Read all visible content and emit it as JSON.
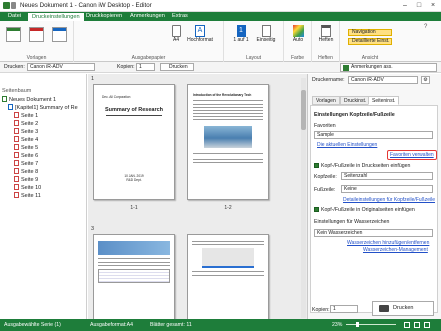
{
  "app": {
    "title": "Neues Dokument 1 - Canon iW Desktop - Editor"
  },
  "ribbon_tabs": [
    "Datei",
    "Druckeinstellungen",
    "Druckkopieren",
    "Anmerkungen",
    "Extras"
  ],
  "ribbon": {
    "groups": {
      "vorlagen": "Vorlagen",
      "ausgabepapier": "Ausgabepapier",
      "layout": "Layout",
      "farbe": "Farbe",
      "heften": "Heften",
      "ansicht": "Ansicht"
    },
    "buttons": {
      "paper_size": "A4",
      "orientation": "Hochformat",
      "pages_per_sheet": "1 auf 1",
      "duplex": "Einseitig",
      "color": "Auto",
      "staple": "Heften",
      "navigation": "Navigation",
      "detailed_info": "Detaillierte Einst."
    }
  },
  "print_row": {
    "printer_label": "Drucken:",
    "printer_value": "Canon iR-ADV",
    "copies_label": "Kopien:",
    "copies_value": "1",
    "print_button": "Drucken",
    "annotations_button": "Anmerkungen ass."
  },
  "tree": {
    "header": "Seitenbaum",
    "root": "Neues Dokument 1",
    "chapter": "[Kapitel1] Summary of Re",
    "pages": [
      "Seite 1",
      "Seite 2",
      "Seite 3",
      "Seite 4",
      "Seite 5",
      "Seite 6",
      "Seite 7",
      "Seite 8",
      "Seite 9",
      "Seite 10",
      "Seite 11"
    ]
  },
  "preview": {
    "spreads": [
      {
        "number": "1",
        "left_label": "1-1",
        "right_label": "1-2"
      },
      {
        "number": "3",
        "left_label": "",
        "right_label": ""
      }
    ],
    "page1": {
      "header": "Dec. All Corporation",
      "title": "Summary of Research",
      "date": "10 JAN. 2019",
      "dept": "R&D Dept."
    },
    "page2": {
      "title": "Introduction of the Revolutionary Tech"
    }
  },
  "panel": {
    "printer_label": "Druckername:",
    "printer_value": "Canon iR-ADV",
    "tabs": [
      "Vorlagen",
      "Druckinst.",
      "Seiteninst."
    ],
    "section_title": "Einstellungen Kopfzeile/Fußzeile",
    "favorites_label": "Favoriten",
    "favorites_value": "Sample",
    "apply_link": "Die aktuellen Einstellungen",
    "manage_link": "Favoriten verwalten",
    "header_check": "Kopf-/Fußzeile in Druckseiten einfügen",
    "kopfzeile_label": "Kopfzeile:",
    "kopfzeile_value": "Seitenzahl",
    "fusszeile_label": "Fußzeile:",
    "fusszeile_value": "Keine",
    "detail_link": "Detaileinstellungen für Kopfzeile/Fußzeile",
    "original_check": "Kopf-/Fußzeile in Originalseiten einfügen",
    "watermark_title": "Einstellungen für Wasserzeichen",
    "watermark_value": "Kein Wasserzeichen",
    "watermark_link1": "Wasserzeichen hinzufügen/entfernen",
    "watermark_link2": "Wasserzeichen-Management",
    "copies_label": "Kopien:",
    "copies_value": "1",
    "print_button": "Drucken"
  },
  "status": {
    "output_series": "Ausgabewählte Serie (1)",
    "output_format": "Ausgabeformat:A4",
    "sheets": "Blätter gesamt: 11",
    "zoom": "23%"
  }
}
